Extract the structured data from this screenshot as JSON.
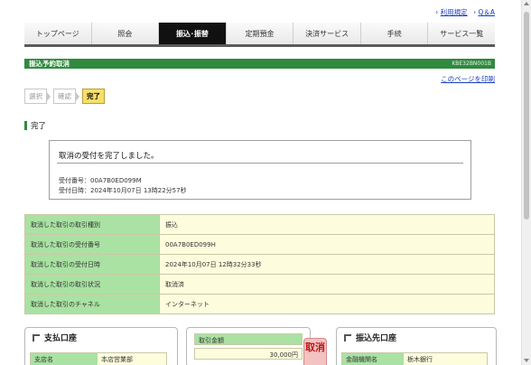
{
  "toplinks": {
    "terms": "利用規定",
    "faq": "Q＆A"
  },
  "nav": {
    "tabs": [
      {
        "label": "トップページ"
      },
      {
        "label": "照会"
      },
      {
        "label": "振込･振替"
      },
      {
        "label": "定期預金"
      },
      {
        "label": "決済サービス"
      },
      {
        "label": "手続"
      },
      {
        "label": "サービス一覧"
      }
    ],
    "active_index": 2
  },
  "page": {
    "title": "振込予約取消",
    "screen_code": "KBE32BN001B",
    "print_link": "このページを印刷"
  },
  "steps": [
    "選択",
    "確認",
    "完了"
  ],
  "section_title": "完了",
  "message": {
    "text": "取消の受付を完了しました。",
    "receipt_no": "受付番号：00A7B0ED099M",
    "receipt_time": "受付日時：2024年10月07日 13時22分57秒"
  },
  "info_rows": [
    {
      "label": "取消した取引の取引種別",
      "value": "振込"
    },
    {
      "label": "取消した取引の受付番号",
      "value": "00A7B0ED099H"
    },
    {
      "label": "取消した取引の受付日時",
      "value": "2024年10月07日 12時32分33秒"
    },
    {
      "label": "取消した取引の取引状況",
      "value": "取消済"
    },
    {
      "label": "取消した取引のチャネル",
      "value": "インターネット"
    }
  ],
  "payment_account": {
    "title": "支払口座",
    "branch_label": "支店名",
    "branch_value": "本店営業部"
  },
  "amount": {
    "label": "取引金額",
    "value": "30,000円"
  },
  "cancel_stamp": "取消",
  "destination_account": {
    "title": "振込先口座",
    "bank_label": "金融機関名",
    "bank_value": "栃木銀行"
  },
  "colors": {
    "accent_green": "#2f8a3e",
    "label_green": "#a9e2a2",
    "value_yellow": "#fdfddd",
    "active_tab": "#111111"
  }
}
